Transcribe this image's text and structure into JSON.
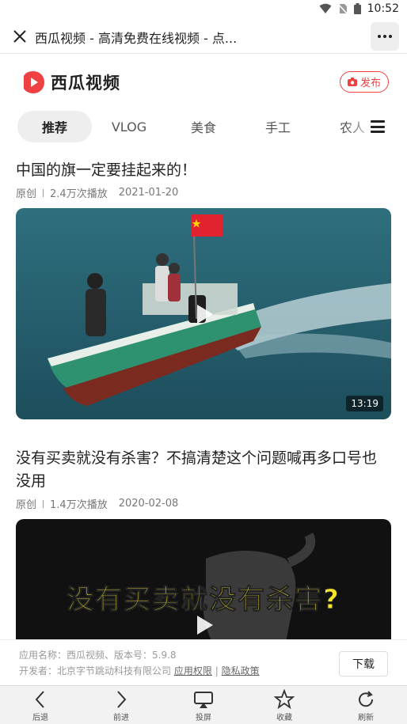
{
  "status_bar": {
    "time": "10:52"
  },
  "browser": {
    "page_title": "西瓜视频 - 高清免费在线视频 - 点..."
  },
  "app_header": {
    "logo_text": "西瓜视频",
    "publish_label": "发布"
  },
  "tabs": [
    {
      "label": "推荐",
      "active": true
    },
    {
      "label": "VLOG"
    },
    {
      "label": "美食"
    },
    {
      "label": "手工"
    },
    {
      "label": "农人"
    }
  ],
  "feed": [
    {
      "title": "中国的旗一定要挂起来的！",
      "source": "原创",
      "plays": "2.4万次播放",
      "date": "2021-01-20",
      "duration": "13:19"
    },
    {
      "title": "没有买卖就没有杀害？不搞清楚这个问题喊再多口号也没用",
      "source": "原创",
      "plays": "1.4万次播放",
      "date": "2020-02-08",
      "overlay_text": "没有买卖就没有杀害?"
    }
  ],
  "app_info": {
    "line1": "应用名称：西瓜视频、版本号：5.9.8",
    "developer": "开发者：北京字节跳动科技有限公司",
    "permissions_link": "应用权限",
    "privacy_link": "隐私政策",
    "separator": "|",
    "download_label": "下载"
  },
  "bottom_nav": {
    "back": "后退",
    "forward": "前进",
    "cast": "投屏",
    "favorite": "收藏",
    "refresh": "刷新"
  },
  "colors": {
    "brand_red": "#f04142",
    "tab_bg": "#eeeeee"
  }
}
